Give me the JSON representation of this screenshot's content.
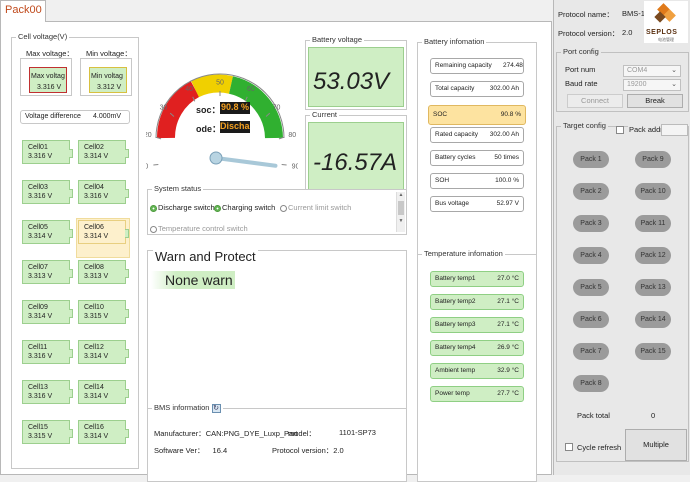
{
  "tab": {
    "label": "Pack00"
  },
  "cell_voltage": {
    "title": "Cell voltage(V)",
    "max_label": "Max voltage：",
    "max_inner": "Max voltag",
    "max_value": "3.316 V",
    "min_label": "Min voltage：",
    "min_inner": "Min voltag",
    "min_value": "3.312 V",
    "diff_label": "Voltage difference",
    "diff_value": "4.000mV",
    "cells": [
      {
        "name": "Cell01",
        "v": "3.316 V"
      },
      {
        "name": "Cell02",
        "v": "3.314 V"
      },
      {
        "name": "Cell03",
        "v": "3.316 V"
      },
      {
        "name": "Cell04",
        "v": "3.316 V"
      },
      {
        "name": "Cell05",
        "v": "3.314 V"
      },
      {
        "name": "Cell06",
        "v": "3.314 V"
      },
      {
        "name": "Cell07",
        "v": "3.313 V"
      },
      {
        "name": "Cell08",
        "v": "3.313 V"
      },
      {
        "name": "Cell09",
        "v": "3.314 V"
      },
      {
        "name": "Cell10",
        "v": "3.315 V"
      },
      {
        "name": "Cell11",
        "v": "3.316 V"
      },
      {
        "name": "Cell12",
        "v": "3.314 V"
      },
      {
        "name": "Cell13",
        "v": "3.316 V"
      },
      {
        "name": "Cell14",
        "v": "3.314 V"
      },
      {
        "name": "Cell15",
        "v": "3.315 V"
      },
      {
        "name": "Cell16",
        "v": "3.314 V"
      }
    ]
  },
  "gauge": {
    "ticks": [
      "0",
      "10",
      "20",
      "30",
      "40",
      "50",
      "60",
      "70",
      "80",
      "90",
      "100"
    ],
    "soc_label": "soc：",
    "soc_value": "90.8 %",
    "mode_label": "ode：",
    "mode_value": "Discha",
    "needle_value": 90.8
  },
  "battery_voltage": {
    "title": "Battery voltage",
    "value": "53.03V"
  },
  "current": {
    "title": "Current",
    "value": "-16.57A"
  },
  "system_status": {
    "title": "System status",
    "items": [
      {
        "label": "Discharge switch",
        "on": true
      },
      {
        "label": "Charging switch",
        "on": true
      },
      {
        "label": "Current limit switch",
        "on": false
      },
      {
        "label": "Temperature control switch",
        "on": false
      }
    ]
  },
  "warn": {
    "title": "Warn and Protect",
    "value": "None warn"
  },
  "bms_info": {
    "title": "BMS information",
    "manufacturer_label": "Manufacturer：",
    "manufacturer_value": "CAN:PNG_DYE_Luxp_Part",
    "model_label": "model：",
    "model_value": "1101-SP73",
    "software_label": "Software Ver：",
    "software_value": "16.4",
    "protocol_label": "Protocol version：",
    "protocol_value": "2.0"
  },
  "battery_info": {
    "title": "Battery infomation",
    "rows": [
      {
        "label": "Remaining capacity",
        "value": "274.48 A"
      },
      {
        "label": "Total capacity",
        "value": "302.00 Ah"
      },
      {
        "label": "SOC",
        "value": "90.8 %"
      },
      {
        "label": "Rated capacity",
        "value": "302.00 Ah"
      },
      {
        "label": "Battery cycles",
        "value": "50 times"
      },
      {
        "label": "SOH",
        "value": "100.0 %"
      },
      {
        "label": "Bus voltage",
        "value": "52.97 V"
      }
    ]
  },
  "temperature_info": {
    "title": "Temperature infomation",
    "rows": [
      {
        "label": "Battery temp1",
        "value": "27.0 °C"
      },
      {
        "label": "Battery temp2",
        "value": "27.1 °C"
      },
      {
        "label": "Battery temp3",
        "value": "27.1 °C"
      },
      {
        "label": "Battery temp4",
        "value": "26.9 °C"
      },
      {
        "label": "Ambient temp",
        "value": "32.9 °C"
      },
      {
        "label": "Power temp",
        "value": "27.7 °C"
      }
    ]
  },
  "right": {
    "protocol_name_label": "Protocol name：",
    "protocol_name_value": "BMS-1",
    "protocol_version_label": "Protocol version：",
    "protocol_version_value": "2.0",
    "logo_text": "SEPLOS",
    "logo_sub": "电池管理",
    "port_config_title": "Port config",
    "port_num_label": "Port num",
    "port_num_value": "COM4",
    "baud_rate_label": "Baud rate",
    "baud_rate_value": "19200",
    "connect_label": "Connect",
    "break_label": "Break",
    "target_config_title": "Target config",
    "pack_addr_label": "Pack addr",
    "packs": [
      "Pack 1",
      "Pack 9",
      "Pack 2",
      "Pack 10",
      "Pack 3",
      "Pack 11",
      "Pack 4",
      "Pack 12",
      "Pack 5",
      "Pack 13",
      "Pack 6",
      "Pack 14",
      "Pack 7",
      "Pack 15",
      "Pack 8"
    ],
    "pack_total_label": "Pack total",
    "pack_total_value": "0",
    "cycle_refresh_label": "Cycle refresh",
    "multiple_label": "Multiple"
  },
  "colors": {
    "green_fill": "#cfeec4",
    "soc_highlight": "#fde3a0",
    "gauge_red": "#e02020",
    "gauge_yellow": "#f0d000",
    "gauge_green": "#30b030",
    "tab_text": "#c04a1c"
  }
}
